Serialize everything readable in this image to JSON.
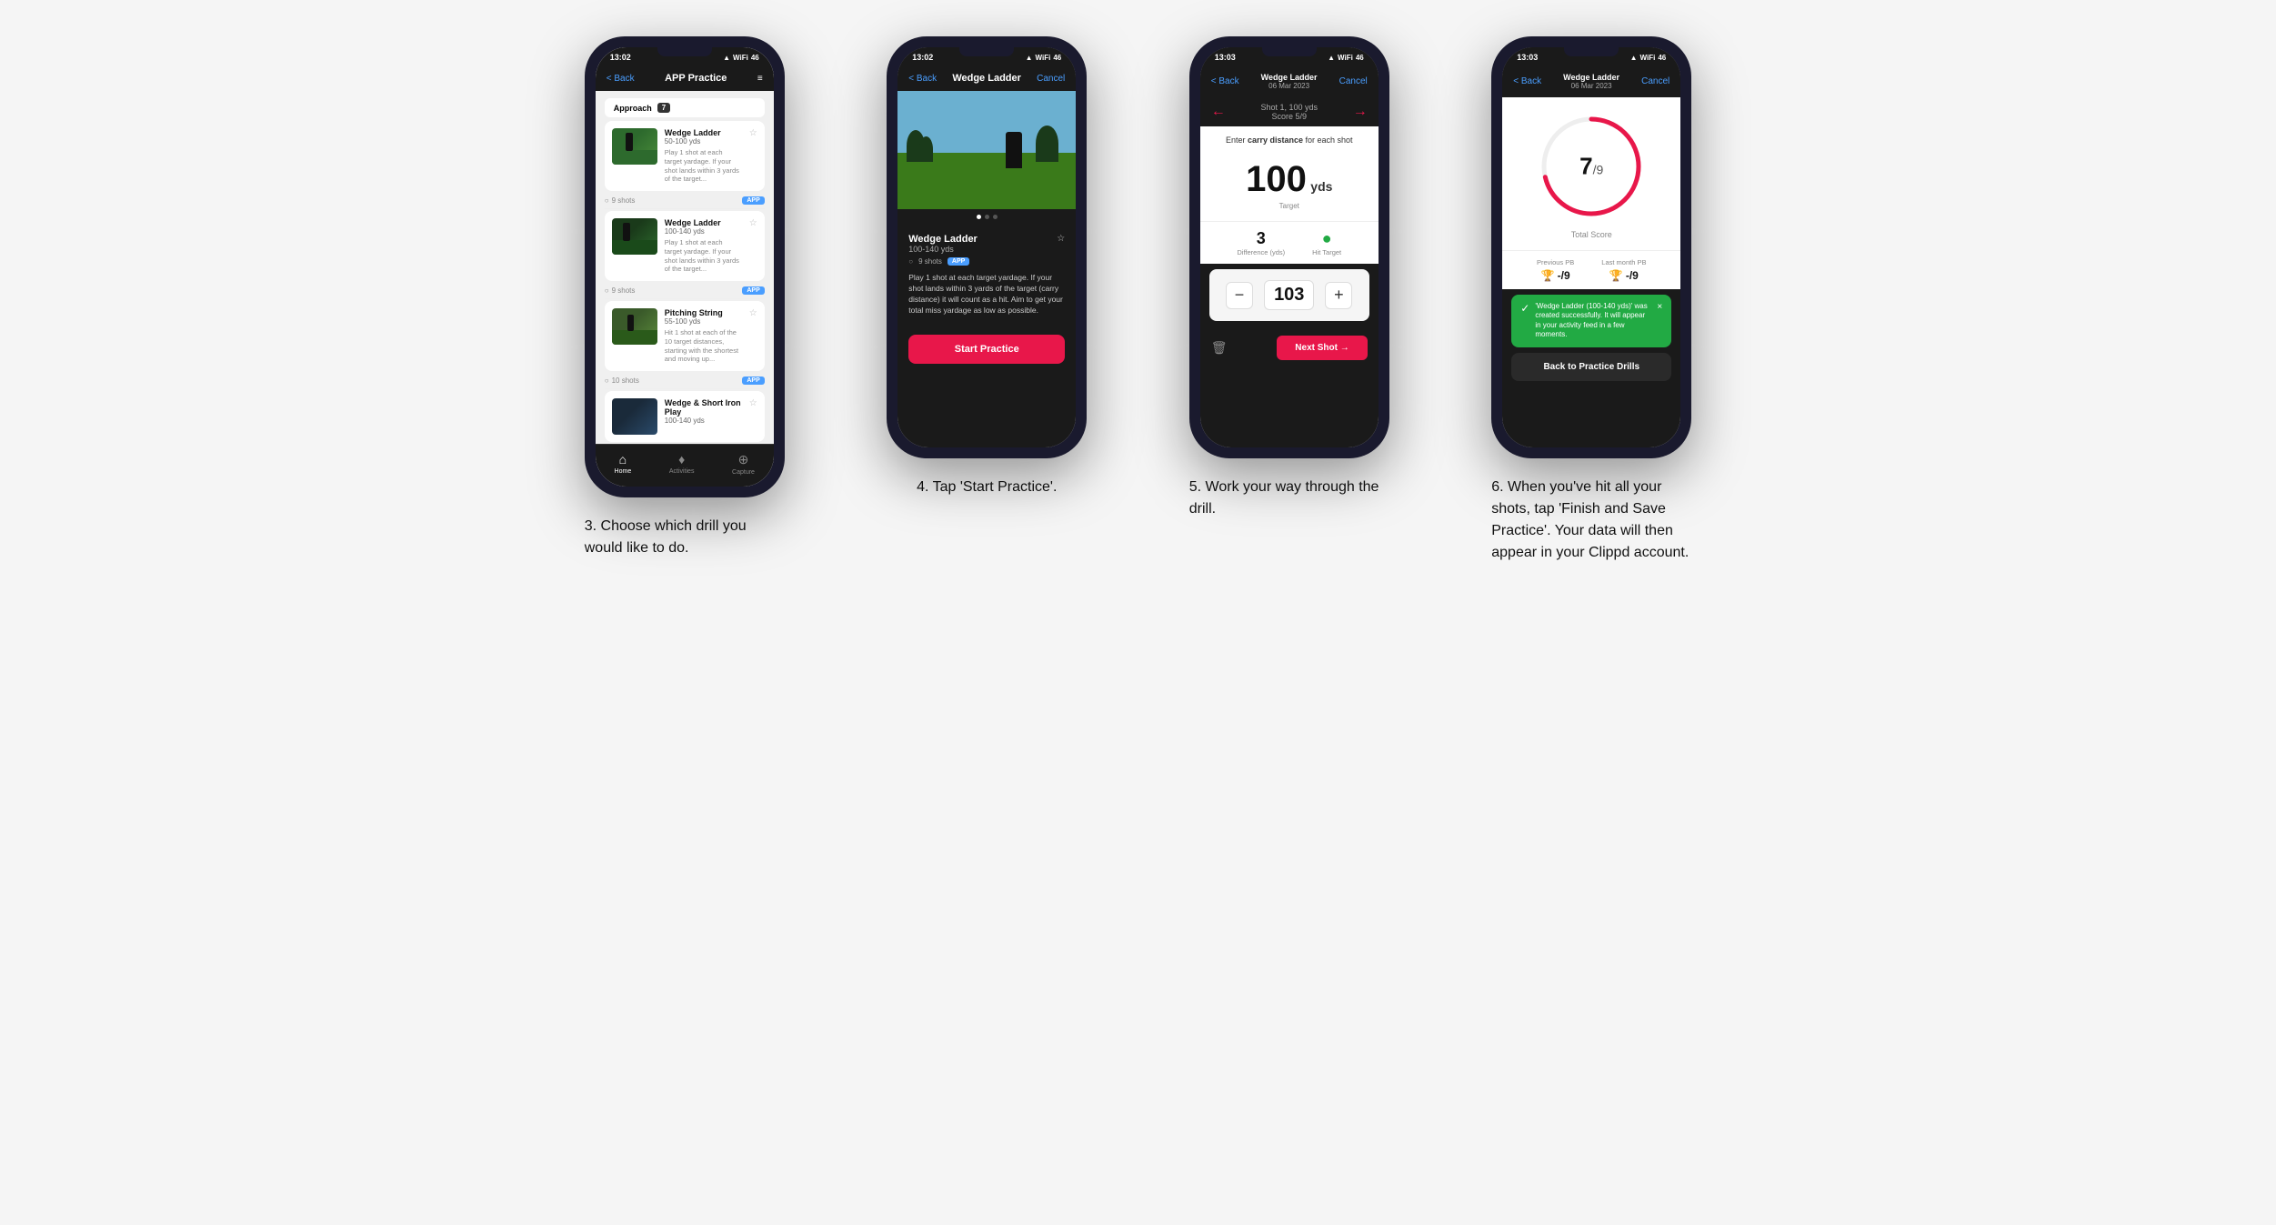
{
  "page": {
    "background": "#f5f5f5"
  },
  "phones": [
    {
      "id": "phone1",
      "statusBar": {
        "time": "13:02",
        "icons": "▲ WiFi 46"
      },
      "nav": {
        "back": "< Back",
        "title": "APP Practice",
        "menu": "≡"
      },
      "category": {
        "label": "Approach",
        "count": "7"
      },
      "drills": [
        {
          "name": "Wedge Ladder",
          "yds": "50-100 yds",
          "desc": "Play 1 shot at each target yardage. If your shot lands within 3 yards of the target...",
          "shots": "9 shots",
          "badge": "APP"
        },
        {
          "name": "Wedge Ladder",
          "yds": "100-140 yds",
          "desc": "Play 1 shot at each target yardage. If your shot lands within 3 yards of the target...",
          "shots": "9 shots",
          "badge": "APP"
        },
        {
          "name": "Pitching String",
          "yds": "55-100 yds",
          "desc": "Hit 1 shot at each of the 10 target distances, starting with the shortest and moving up...",
          "shots": "10 shots",
          "badge": "APP"
        },
        {
          "name": "Wedge & Short Iron Play",
          "yds": "100-140 yds",
          "desc": "",
          "shots": "",
          "badge": ""
        }
      ],
      "bottomNav": [
        {
          "label": "Home",
          "icon": "⌂",
          "active": true
        },
        {
          "label": "Activities",
          "icon": "⊕",
          "active": false
        },
        {
          "label": "Capture",
          "icon": "⊕",
          "active": false
        }
      ],
      "caption": "3. Choose which drill you would like to do."
    },
    {
      "id": "phone2",
      "statusBar": {
        "time": "13:02",
        "icons": "▲ WiFi 46"
      },
      "nav": {
        "back": "< Back",
        "title": "Wedge Ladder",
        "cancel": "Cancel"
      },
      "detail": {
        "name": "Wedge Ladder",
        "yds": "100-140 yds",
        "shots": "9 shots",
        "badge": "APP",
        "desc": "Play 1 shot at each target yardage. If your shot lands within 3 yards of the target (carry distance) it will count as a hit. Aim to get your total miss yardage as low as possible."
      },
      "startButton": "Start Practice",
      "caption": "4. Tap 'Start Practice'."
    },
    {
      "id": "phone3",
      "statusBar": {
        "time": "13:03",
        "icons": "▲ WiFi 46"
      },
      "nav": {
        "back": "< Back",
        "titleLine1": "Wedge Ladder",
        "titleLine2": "06 Mar 2023",
        "cancel": "Cancel"
      },
      "shotNav": {
        "prevArrow": "←",
        "shotTitle": "Shot 1, 100 yds",
        "scoreLabel": "Score 5/9",
        "nextArrow": "→"
      },
      "instruction": "Enter carry distance for each shot",
      "target": {
        "number": "100",
        "unit": "yds",
        "label": "Target"
      },
      "result": {
        "difference": "3",
        "differenceLabel": "Difference (yds)",
        "hitTarget": "Hit Target"
      },
      "inputValue": "103",
      "nextShotButton": "Next Shot →",
      "caption": "5. Work your way through the drill."
    },
    {
      "id": "phone4",
      "statusBar": {
        "time": "13:03",
        "icons": "▲ WiFi 46"
      },
      "nav": {
        "back": "< Back",
        "titleLine1": "Wedge Ladder",
        "titleLine2": "06 Mar 2023",
        "cancel": "Cancel"
      },
      "score": {
        "number": "7",
        "denom": "/9",
        "label": "Total Score"
      },
      "pb": {
        "previousLabel": "Previous PB",
        "previousValue": "-/9",
        "lastMonthLabel": "Last month PB",
        "lastMonthValue": "-/9"
      },
      "toast": {
        "message": "'Wedge Ladder (100-140 yds)' was created successfully. It will appear in your activity feed in a few moments.",
        "closeIcon": "×"
      },
      "backButton": "Back to Practice Drills",
      "caption": "6. When you've hit all your shots, tap 'Finish and Save Practice'. Your data will then appear in your Clippd account."
    }
  ]
}
